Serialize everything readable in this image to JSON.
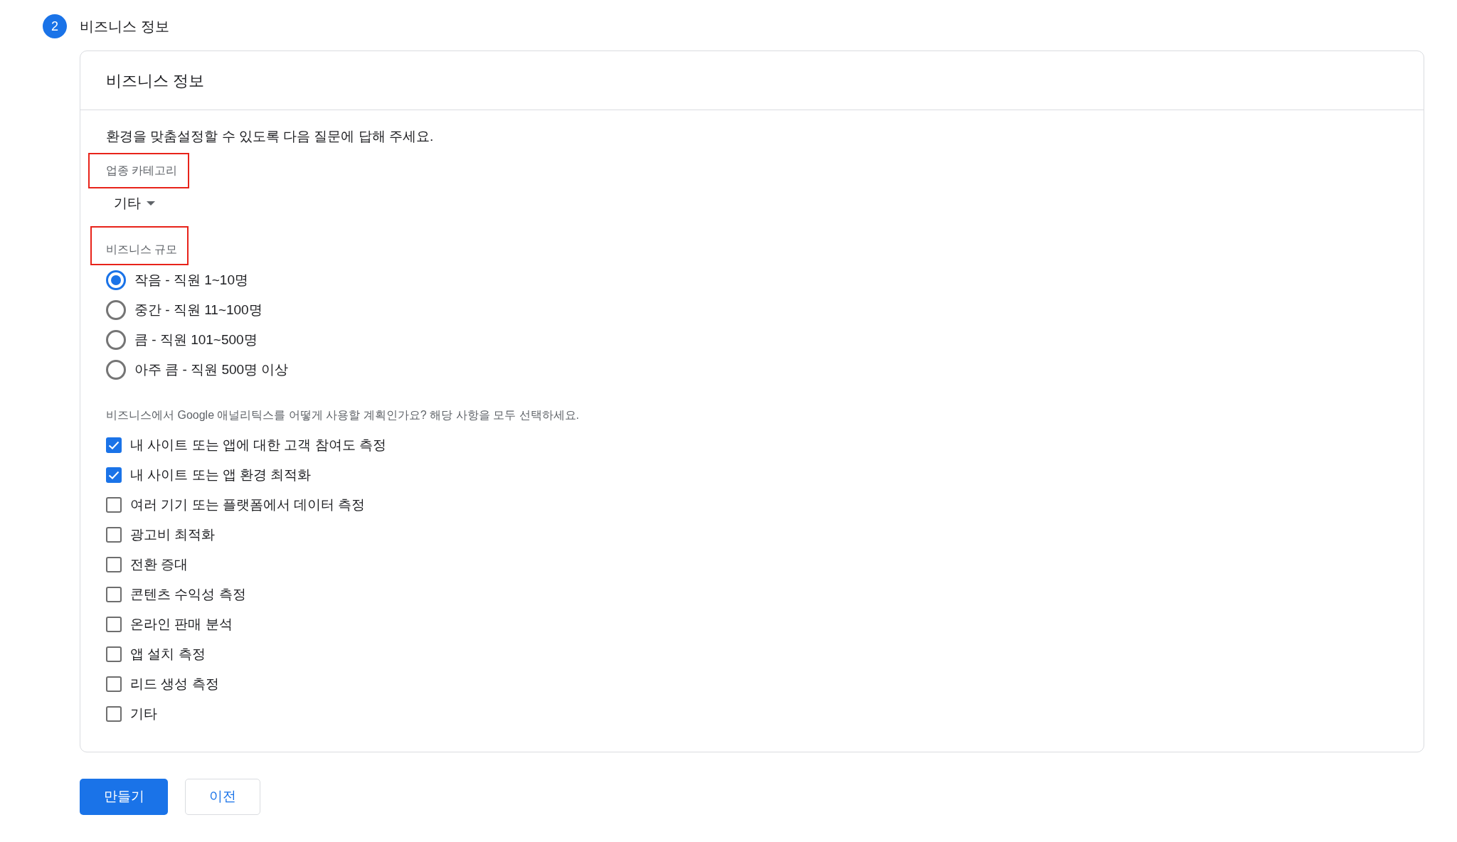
{
  "step": {
    "number": "2",
    "title": "비즈니스 정보"
  },
  "card": {
    "title": "비즈니스 정보",
    "intro": "환경을 맞춤설정할 수 있도록 다음 질문에 답해 주세요.",
    "industry": {
      "label": "업종 카테고리",
      "highlighted": true,
      "value": "기타"
    },
    "size": {
      "label": "비즈니스 규모",
      "highlighted": true,
      "options": [
        {
          "label": "작음 - 직원 1~10명",
          "selected": true
        },
        {
          "label": "중간 - 직원 11~100명",
          "selected": false
        },
        {
          "label": "큼 - 직원 101~500명",
          "selected": false
        },
        {
          "label": "아주 큼 - 직원 500명 이상",
          "selected": false
        }
      ]
    },
    "usage": {
      "question": "비즈니스에서 Google 애널리틱스를 어떻게 사용할 계획인가요? 해당 사항을 모두 선택하세요.",
      "options": [
        {
          "label": "내 사이트 또는 앱에 대한 고객 참여도 측정",
          "checked": true
        },
        {
          "label": "내 사이트 또는 앱 환경 최적화",
          "checked": true
        },
        {
          "label": "여러 기기 또는 플랫폼에서 데이터 측정",
          "checked": false
        },
        {
          "label": "광고비 최적화",
          "checked": false
        },
        {
          "label": "전환 증대",
          "checked": false
        },
        {
          "label": "콘텐츠 수익성 측정",
          "checked": false
        },
        {
          "label": "온라인 판매 분석",
          "checked": false
        },
        {
          "label": "앱 설치 측정",
          "checked": false
        },
        {
          "label": "리드 생성 측정",
          "checked": false
        },
        {
          "label": "기타",
          "checked": false
        }
      ]
    }
  },
  "buttons": [
    {
      "label": "만들기",
      "kind": "primary"
    },
    {
      "label": "이전",
      "kind": "secondary"
    }
  ]
}
